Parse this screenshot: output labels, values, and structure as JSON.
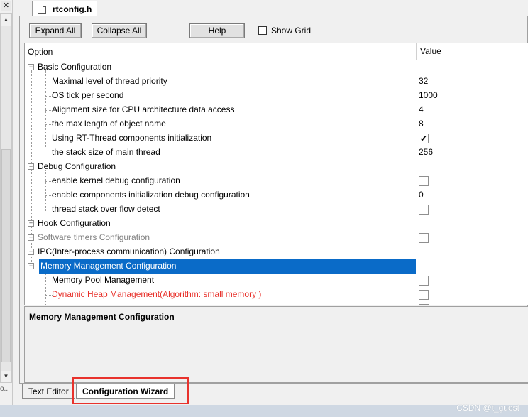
{
  "left_panel": {
    "close_glyph": "✕",
    "bottom_text": "o..."
  },
  "file_tab": {
    "name": "rtconfig.h"
  },
  "toolbar": {
    "expand_all": "Expand All",
    "collapse_all": "Collapse All",
    "help": "Help",
    "show_grid": "Show Grid",
    "show_grid_checked": false
  },
  "grid": {
    "header_option": "Option",
    "header_value": "Value",
    "rows": [
      {
        "label": "Basic Configuration",
        "value": ""
      },
      {
        "label": "Maximal level of thread priority",
        "value": "32"
      },
      {
        "label": "OS tick per second",
        "value": "1000"
      },
      {
        "label": "Alignment size for CPU architecture data access",
        "value": "4"
      },
      {
        "label": "the max length of object name",
        "value": "8"
      },
      {
        "label": "Using RT-Thread components initialization",
        "value": "✔"
      },
      {
        "label": "the stack size of main thread",
        "value": "256"
      },
      {
        "label": "Debug Configuration",
        "value": ""
      },
      {
        "label": "enable kernel debug configuration",
        "value": ""
      },
      {
        "label": "enable components initialization debug configuration",
        "value": "0"
      },
      {
        "label": "thread stack over flow detect",
        "value": ""
      },
      {
        "label": "Hook Configuration",
        "value": ""
      },
      {
        "label": "Software timers Configuration",
        "value": ""
      },
      {
        "label": "IPC(Inter-process communication) Configuration",
        "value": ""
      },
      {
        "label": "Memory Management Configuration",
        "value": ""
      },
      {
        "label": "Memory Pool Management",
        "value": ""
      },
      {
        "label": "Dynamic Heap Management(Algorithm: small memory )",
        "value": ""
      }
    ]
  },
  "description": {
    "title": "Memory Management Configuration"
  },
  "bottom_tabs": {
    "text_editor": "Text Editor",
    "config_wizard": "Configuration Wizard"
  },
  "watermark": "CSDN @t_guest",
  "colors": {
    "selection": "#0a6bc8",
    "warning_text": "#e8322c",
    "disabled_text": "#808080",
    "highlight_box": "#e8322c"
  }
}
